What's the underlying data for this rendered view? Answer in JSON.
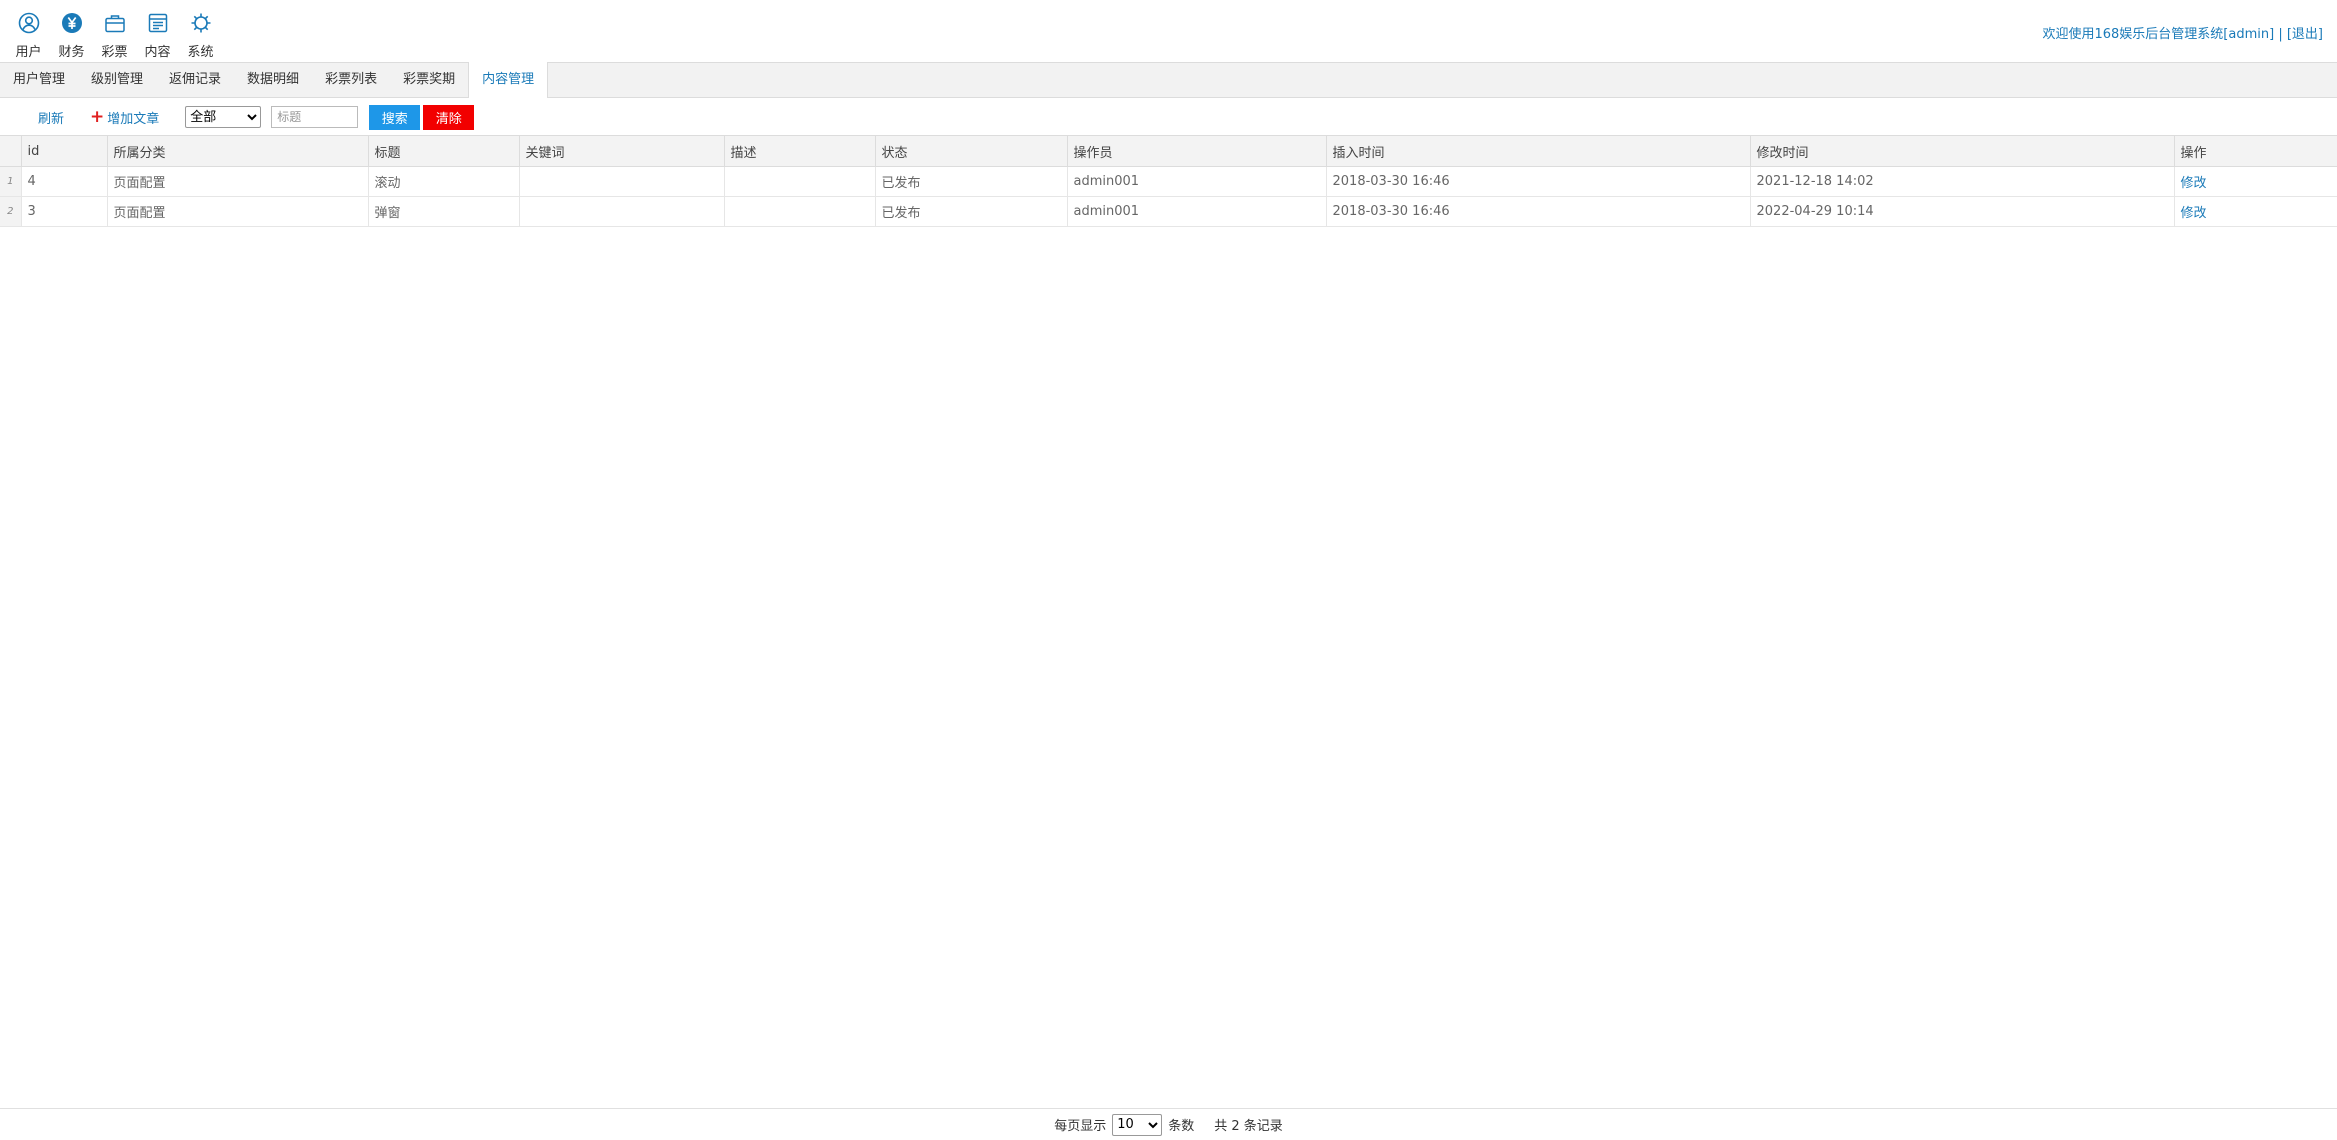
{
  "topnav": {
    "items": [
      {
        "label": "用户",
        "icon": "user-icon"
      },
      {
        "label": "财务",
        "icon": "yen-icon"
      },
      {
        "label": "彩票",
        "icon": "briefcase-icon"
      },
      {
        "label": "内容",
        "icon": "content-icon"
      },
      {
        "label": "系统",
        "icon": "gear-icon"
      }
    ],
    "welcome_text": "欢迎使用168娱乐后台管理系统[admin]",
    "separator": " | ",
    "logout_label": "[退出]"
  },
  "tabs": [
    {
      "label": "用户管理"
    },
    {
      "label": "级别管理"
    },
    {
      "label": "返佣记录"
    },
    {
      "label": "数据明细"
    },
    {
      "label": "彩票列表"
    },
    {
      "label": "彩票奖期"
    },
    {
      "label": "内容管理"
    }
  ],
  "active_tab": 6,
  "toolbar": {
    "refresh_label": "刷新",
    "add_label": "增加文章",
    "category_selected": "全部",
    "title_placeholder": "标题",
    "search_label": "搜索",
    "clear_label": "清除"
  },
  "table": {
    "columns": [
      "id",
      "所属分类",
      "标题",
      "关键词",
      "描述",
      "状态",
      "操作员",
      "插入时间",
      "修改时间",
      "操作"
    ],
    "rows": [
      {
        "rownum": "1",
        "id": "4",
        "category": "页面配置",
        "title": "滚动",
        "keywords": "",
        "description": "",
        "status": "已发布",
        "operator": "admin001",
        "inserted": "2018-03-30 16:46",
        "modified": "2021-12-18 14:02",
        "action": "修改"
      },
      {
        "rownum": "2",
        "id": "3",
        "category": "页面配置",
        "title": "弹窗",
        "keywords": "",
        "description": "",
        "status": "已发布",
        "operator": "admin001",
        "inserted": "2018-03-30 16:46",
        "modified": "2022-04-29 10:14",
        "action": "修改"
      }
    ]
  },
  "pager": {
    "per_page_label": "每页显示",
    "per_page_value": "10",
    "unit_label": "条数",
    "total_label": "共 2 条记录"
  },
  "colors": {
    "accent": "#1a7ab8",
    "search_button": "#1e97e8",
    "clear_button": "#f20000",
    "status_published": "#a00000"
  }
}
